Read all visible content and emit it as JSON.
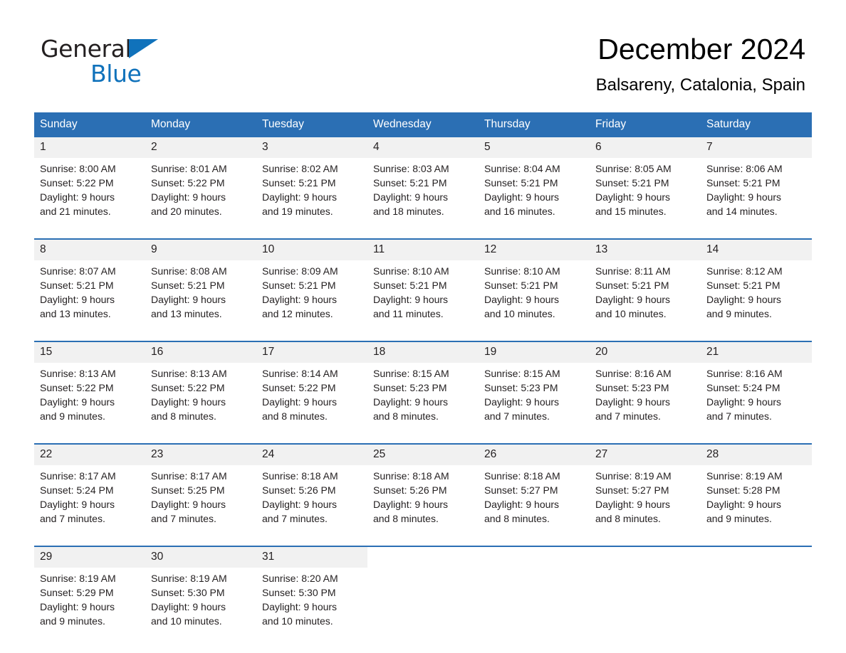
{
  "brand": {
    "name_part1": "General",
    "name_part2": "Blue",
    "logo_icon": "triangle-icon",
    "accent_color": "#1072bb"
  },
  "header": {
    "title": "December 2024",
    "location": "Balsareny, Catalonia, Spain"
  },
  "calendar": {
    "header_bg": "#2b6fb4",
    "daynum_bg": "#f1f1f1",
    "weekdays": [
      "Sunday",
      "Monday",
      "Tuesday",
      "Wednesday",
      "Thursday",
      "Friday",
      "Saturday"
    ],
    "weeks": [
      {
        "days": [
          {
            "num": "1",
            "sunrise": "Sunrise: 8:00 AM",
            "sunset": "Sunset: 5:22 PM",
            "daylight1": "Daylight: 9 hours",
            "daylight2": "and 21 minutes."
          },
          {
            "num": "2",
            "sunrise": "Sunrise: 8:01 AM",
            "sunset": "Sunset: 5:22 PM",
            "daylight1": "Daylight: 9 hours",
            "daylight2": "and 20 minutes."
          },
          {
            "num": "3",
            "sunrise": "Sunrise: 8:02 AM",
            "sunset": "Sunset: 5:21 PM",
            "daylight1": "Daylight: 9 hours",
            "daylight2": "and 19 minutes."
          },
          {
            "num": "4",
            "sunrise": "Sunrise: 8:03 AM",
            "sunset": "Sunset: 5:21 PM",
            "daylight1": "Daylight: 9 hours",
            "daylight2": "and 18 minutes."
          },
          {
            "num": "5",
            "sunrise": "Sunrise: 8:04 AM",
            "sunset": "Sunset: 5:21 PM",
            "daylight1": "Daylight: 9 hours",
            "daylight2": "and 16 minutes."
          },
          {
            "num": "6",
            "sunrise": "Sunrise: 8:05 AM",
            "sunset": "Sunset: 5:21 PM",
            "daylight1": "Daylight: 9 hours",
            "daylight2": "and 15 minutes."
          },
          {
            "num": "7",
            "sunrise": "Sunrise: 8:06 AM",
            "sunset": "Sunset: 5:21 PM",
            "daylight1": "Daylight: 9 hours",
            "daylight2": "and 14 minutes."
          }
        ]
      },
      {
        "days": [
          {
            "num": "8",
            "sunrise": "Sunrise: 8:07 AM",
            "sunset": "Sunset: 5:21 PM",
            "daylight1": "Daylight: 9 hours",
            "daylight2": "and 13 minutes."
          },
          {
            "num": "9",
            "sunrise": "Sunrise: 8:08 AM",
            "sunset": "Sunset: 5:21 PM",
            "daylight1": "Daylight: 9 hours",
            "daylight2": "and 13 minutes."
          },
          {
            "num": "10",
            "sunrise": "Sunrise: 8:09 AM",
            "sunset": "Sunset: 5:21 PM",
            "daylight1": "Daylight: 9 hours",
            "daylight2": "and 12 minutes."
          },
          {
            "num": "11",
            "sunrise": "Sunrise: 8:10 AM",
            "sunset": "Sunset: 5:21 PM",
            "daylight1": "Daylight: 9 hours",
            "daylight2": "and 11 minutes."
          },
          {
            "num": "12",
            "sunrise": "Sunrise: 8:10 AM",
            "sunset": "Sunset: 5:21 PM",
            "daylight1": "Daylight: 9 hours",
            "daylight2": "and 10 minutes."
          },
          {
            "num": "13",
            "sunrise": "Sunrise: 8:11 AM",
            "sunset": "Sunset: 5:21 PM",
            "daylight1": "Daylight: 9 hours",
            "daylight2": "and 10 minutes."
          },
          {
            "num": "14",
            "sunrise": "Sunrise: 8:12 AM",
            "sunset": "Sunset: 5:21 PM",
            "daylight1": "Daylight: 9 hours",
            "daylight2": "and 9 minutes."
          }
        ]
      },
      {
        "days": [
          {
            "num": "15",
            "sunrise": "Sunrise: 8:13 AM",
            "sunset": "Sunset: 5:22 PM",
            "daylight1": "Daylight: 9 hours",
            "daylight2": "and 9 minutes."
          },
          {
            "num": "16",
            "sunrise": "Sunrise: 8:13 AM",
            "sunset": "Sunset: 5:22 PM",
            "daylight1": "Daylight: 9 hours",
            "daylight2": "and 8 minutes."
          },
          {
            "num": "17",
            "sunrise": "Sunrise: 8:14 AM",
            "sunset": "Sunset: 5:22 PM",
            "daylight1": "Daylight: 9 hours",
            "daylight2": "and 8 minutes."
          },
          {
            "num": "18",
            "sunrise": "Sunrise: 8:15 AM",
            "sunset": "Sunset: 5:23 PM",
            "daylight1": "Daylight: 9 hours",
            "daylight2": "and 8 minutes."
          },
          {
            "num": "19",
            "sunrise": "Sunrise: 8:15 AM",
            "sunset": "Sunset: 5:23 PM",
            "daylight1": "Daylight: 9 hours",
            "daylight2": "and 7 minutes."
          },
          {
            "num": "20",
            "sunrise": "Sunrise: 8:16 AM",
            "sunset": "Sunset: 5:23 PM",
            "daylight1": "Daylight: 9 hours",
            "daylight2": "and 7 minutes."
          },
          {
            "num": "21",
            "sunrise": "Sunrise: 8:16 AM",
            "sunset": "Sunset: 5:24 PM",
            "daylight1": "Daylight: 9 hours",
            "daylight2": "and 7 minutes."
          }
        ]
      },
      {
        "days": [
          {
            "num": "22",
            "sunrise": "Sunrise: 8:17 AM",
            "sunset": "Sunset: 5:24 PM",
            "daylight1": "Daylight: 9 hours",
            "daylight2": "and 7 minutes."
          },
          {
            "num": "23",
            "sunrise": "Sunrise: 8:17 AM",
            "sunset": "Sunset: 5:25 PM",
            "daylight1": "Daylight: 9 hours",
            "daylight2": "and 7 minutes."
          },
          {
            "num": "24",
            "sunrise": "Sunrise: 8:18 AM",
            "sunset": "Sunset: 5:26 PM",
            "daylight1": "Daylight: 9 hours",
            "daylight2": "and 7 minutes."
          },
          {
            "num": "25",
            "sunrise": "Sunrise: 8:18 AM",
            "sunset": "Sunset: 5:26 PM",
            "daylight1": "Daylight: 9 hours",
            "daylight2": "and 8 minutes."
          },
          {
            "num": "26",
            "sunrise": "Sunrise: 8:18 AM",
            "sunset": "Sunset: 5:27 PM",
            "daylight1": "Daylight: 9 hours",
            "daylight2": "and 8 minutes."
          },
          {
            "num": "27",
            "sunrise": "Sunrise: 8:19 AM",
            "sunset": "Sunset: 5:27 PM",
            "daylight1": "Daylight: 9 hours",
            "daylight2": "and 8 minutes."
          },
          {
            "num": "28",
            "sunrise": "Sunrise: 8:19 AM",
            "sunset": "Sunset: 5:28 PM",
            "daylight1": "Daylight: 9 hours",
            "daylight2": "and 9 minutes."
          }
        ]
      },
      {
        "days": [
          {
            "num": "29",
            "sunrise": "Sunrise: 8:19 AM",
            "sunset": "Sunset: 5:29 PM",
            "daylight1": "Daylight: 9 hours",
            "daylight2": "and 9 minutes."
          },
          {
            "num": "30",
            "sunrise": "Sunrise: 8:19 AM",
            "sunset": "Sunset: 5:30 PM",
            "daylight1": "Daylight: 9 hours",
            "daylight2": "and 10 minutes."
          },
          {
            "num": "31",
            "sunrise": "Sunrise: 8:20 AM",
            "sunset": "Sunset: 5:30 PM",
            "daylight1": "Daylight: 9 hours",
            "daylight2": "and 10 minutes."
          },
          {
            "num": "",
            "sunrise": "",
            "sunset": "",
            "daylight1": "",
            "daylight2": ""
          },
          {
            "num": "",
            "sunrise": "",
            "sunset": "",
            "daylight1": "",
            "daylight2": ""
          },
          {
            "num": "",
            "sunrise": "",
            "sunset": "",
            "daylight1": "",
            "daylight2": ""
          },
          {
            "num": "",
            "sunrise": "",
            "sunset": "",
            "daylight1": "",
            "daylight2": ""
          }
        ]
      }
    ]
  }
}
